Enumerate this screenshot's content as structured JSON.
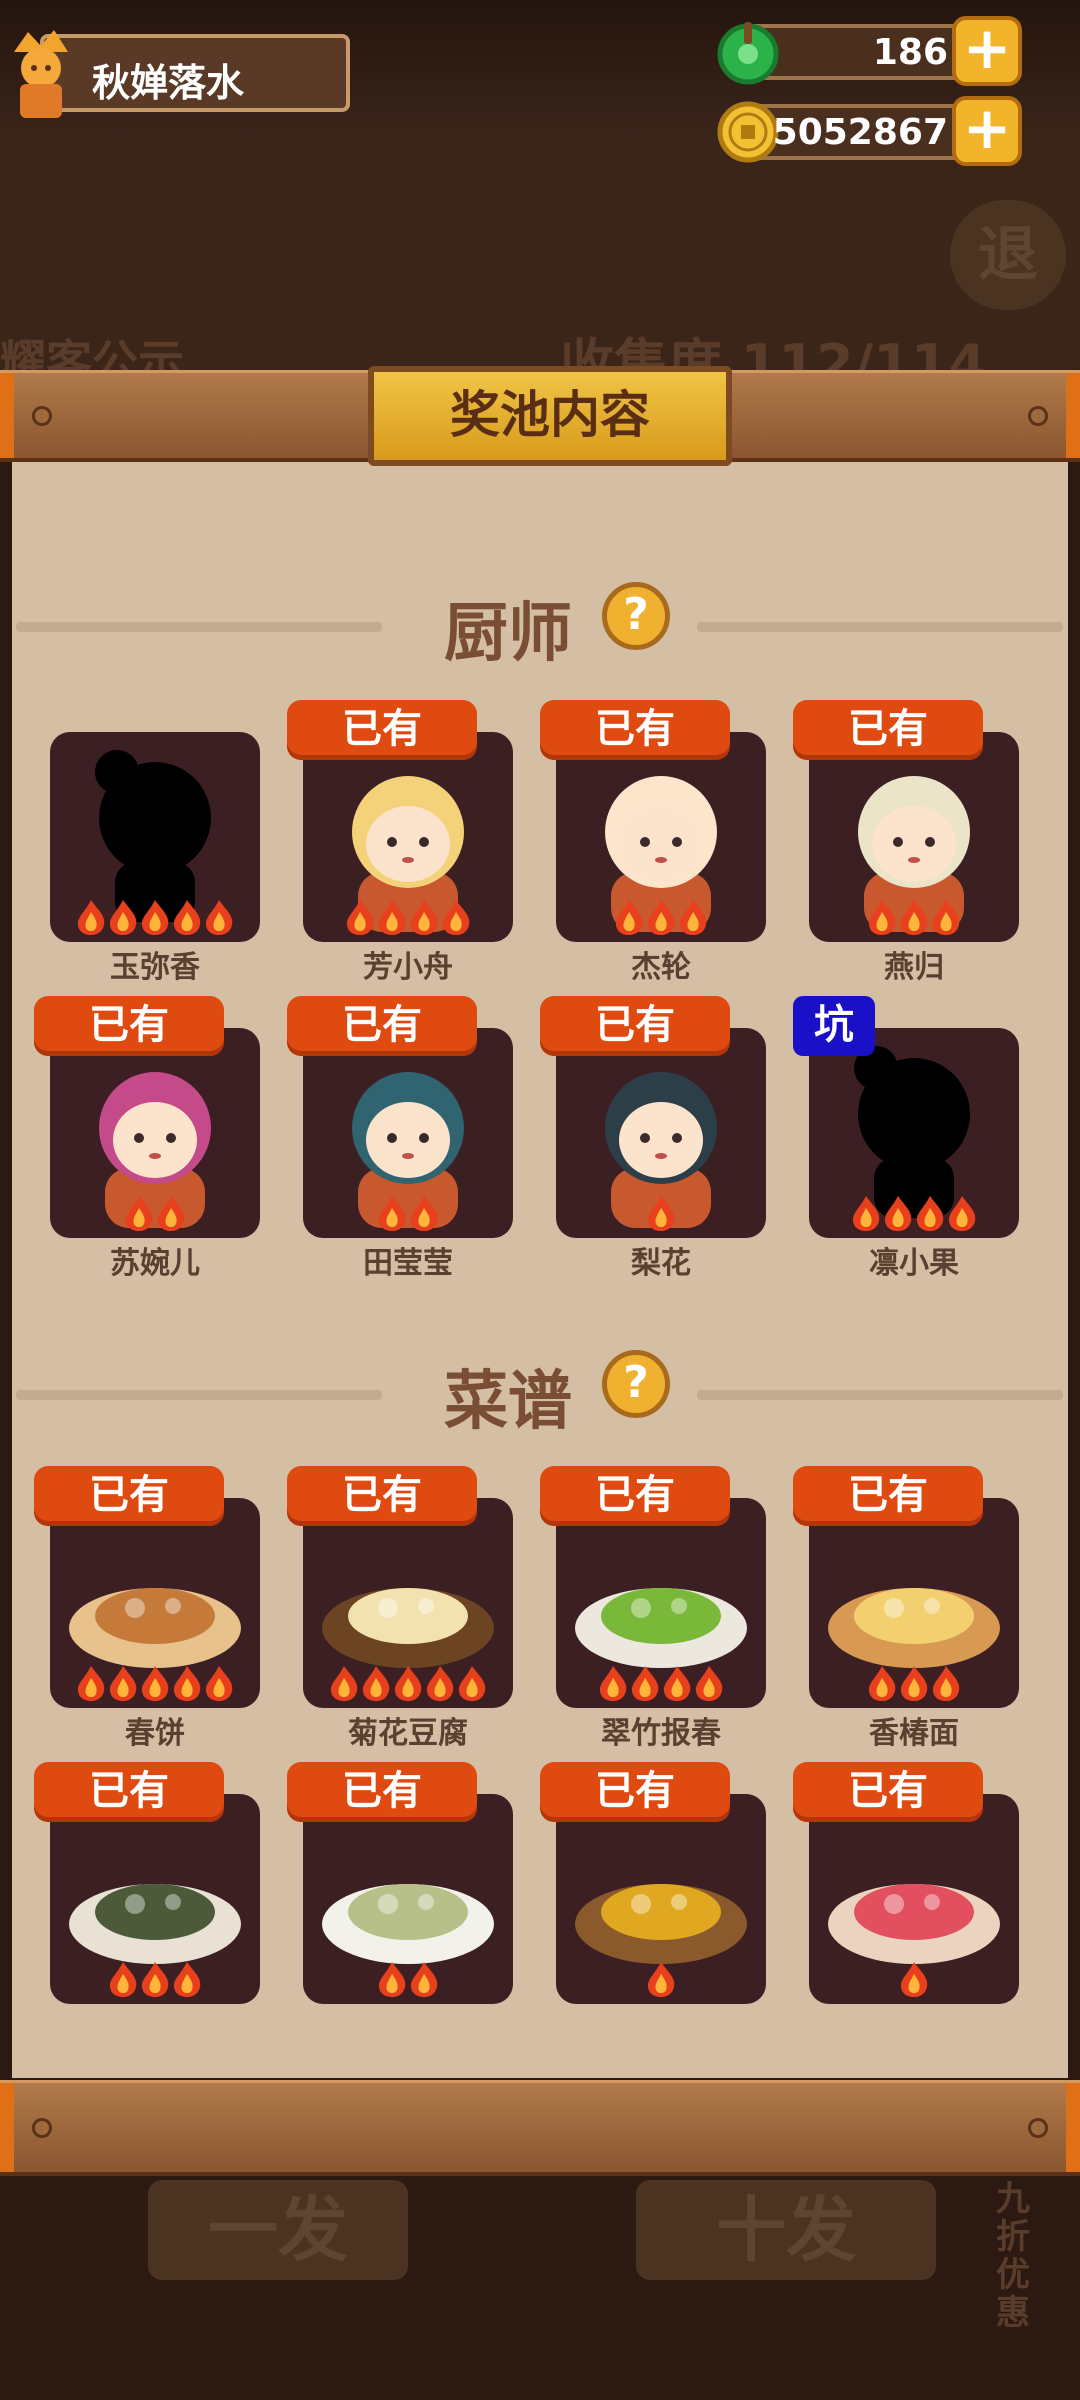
{
  "header": {
    "player_name": "秋婵落水",
    "jade_count": "186",
    "coin_count": "5052867"
  },
  "background": {
    "return_label": "退",
    "left_banner": "耀客公示",
    "right_banner": "收集度 112/114",
    "single_draw": "一发",
    "ten_draw": "十发",
    "discount": "九折优惠"
  },
  "panel": {
    "title": "奖池内容",
    "chef_section": {
      "title": "厨师",
      "items": [
        {
          "name": "玉弥香",
          "badge": "",
          "stars": 5,
          "art": "silhouette"
        },
        {
          "name": "芳小舟",
          "badge": "已有",
          "stars": 4,
          "art": "chef-blonde"
        },
        {
          "name": "杰轮",
          "badge": "已有",
          "stars": 3,
          "art": "chef-baby"
        },
        {
          "name": "燕归",
          "badge": "已有",
          "stars": 3,
          "art": "chef-bun"
        },
        {
          "name": "苏婉儿",
          "badge": "已有",
          "stars": 2,
          "art": "chef-pink"
        },
        {
          "name": "田莹莹",
          "badge": "已有",
          "stars": 2,
          "art": "chef-teal"
        },
        {
          "name": "梨花",
          "badge": "已有",
          "stars": 1,
          "art": "chef-flower"
        },
        {
          "name": "凛小果",
          "badge": "坑",
          "stars": 4,
          "art": "silhouette"
        }
      ]
    },
    "recipe_section": {
      "title": "菜谱",
      "items": [
        {
          "name": "春饼",
          "badge": "已有",
          "stars": 5,
          "art": "dish-platter"
        },
        {
          "name": "菊花豆腐",
          "badge": "已有",
          "stars": 5,
          "art": "dish-tray"
        },
        {
          "name": "翠竹报春",
          "badge": "已有",
          "stars": 4,
          "art": "dish-green"
        },
        {
          "name": "香椿面",
          "badge": "已有",
          "stars": 3,
          "art": "dish-noodle"
        },
        {
          "name": "",
          "badge": "已有",
          "stars": 3,
          "art": "dish-clam"
        },
        {
          "name": "",
          "badge": "已有",
          "stars": 2,
          "art": "dish-board"
        },
        {
          "name": "",
          "badge": "已有",
          "stars": 1,
          "art": "dish-bowl"
        },
        {
          "name": "",
          "badge": "已有",
          "stars": 1,
          "art": "dish-dessert"
        }
      ]
    }
  },
  "colors": {
    "badge_owned": "#de4a10",
    "badge_pit": "#1a10c8",
    "card_bg": "#3c1f23",
    "panel_bg": "#d4bfa4",
    "title_gold": "#f0c446"
  }
}
